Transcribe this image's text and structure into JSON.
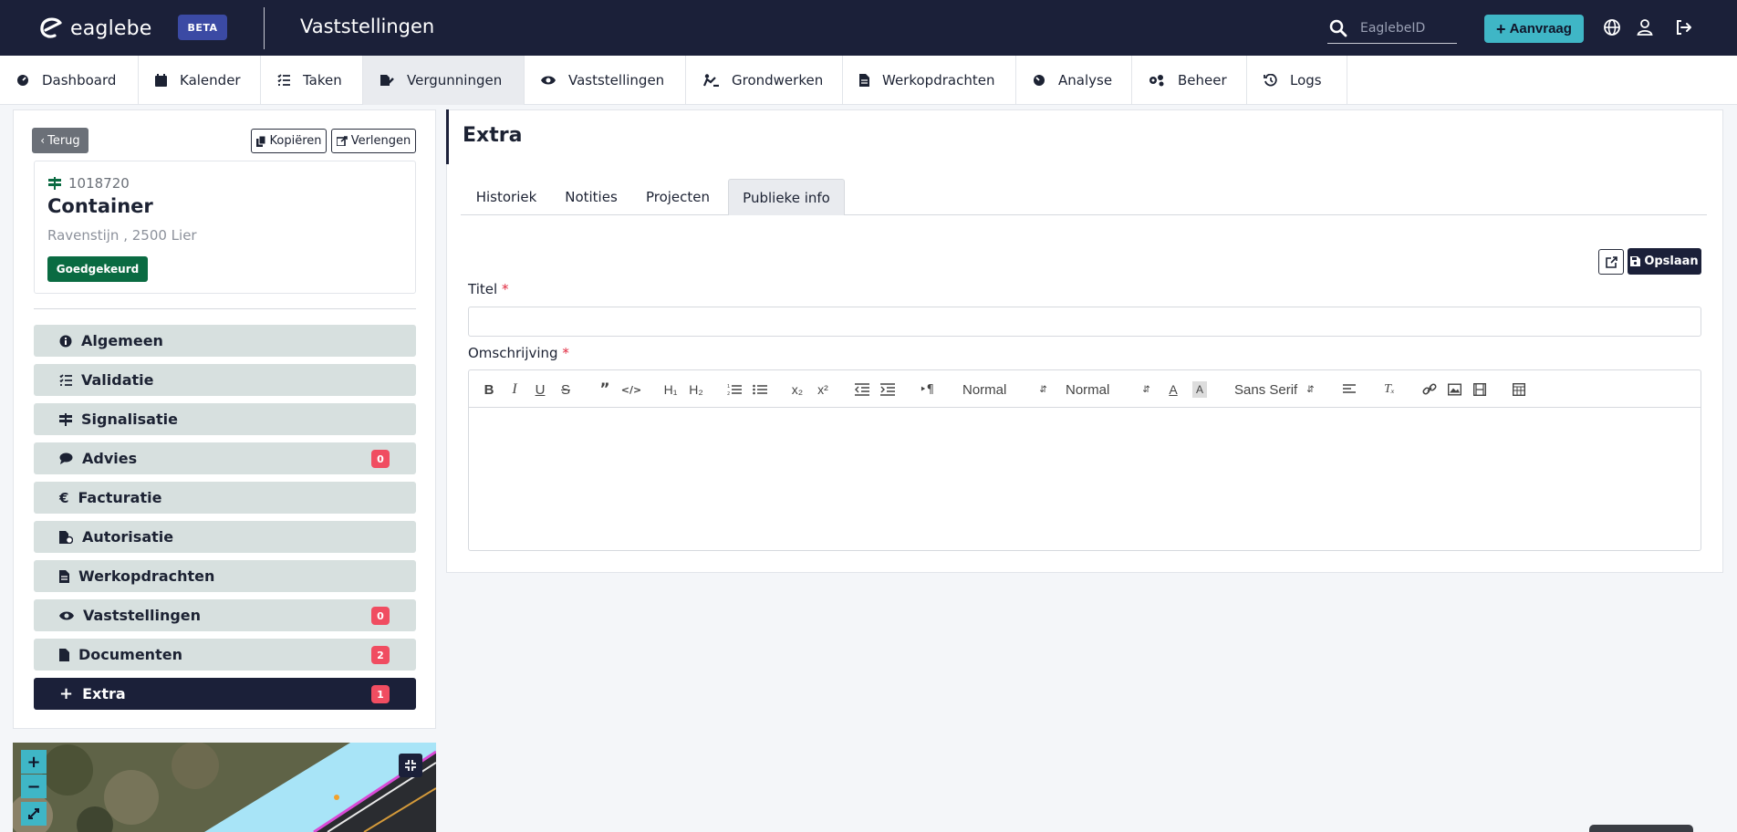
{
  "header": {
    "logo_text": "eaglebe",
    "beta_label": "BETA",
    "title": "Vaststellingen",
    "search_placeholder": "EaglebeID",
    "aanvraag_label": "Aanvraag",
    "icons": [
      "globe-icon",
      "user-icon",
      "logout-icon"
    ]
  },
  "nav": {
    "items": [
      {
        "label": "Dashboard",
        "icon": "dashboard-icon"
      },
      {
        "label": "Kalender",
        "icon": "calendar-icon"
      },
      {
        "label": "Taken",
        "icon": "tasks-icon"
      },
      {
        "label": "Vergunningen",
        "icon": "permit-icon",
        "active": true
      },
      {
        "label": "Vaststellingen",
        "icon": "eye-icon"
      },
      {
        "label": "Grondwerken",
        "icon": "digging-icon"
      },
      {
        "label": "Werkopdrachten",
        "icon": "file-icon"
      },
      {
        "label": "Analyse",
        "icon": "gauge-icon"
      },
      {
        "label": "Beheer",
        "icon": "gears-icon"
      },
      {
        "label": "Logs",
        "icon": "history-icon"
      }
    ]
  },
  "detail": {
    "back_label": "Terug",
    "copy_label": "Kopiëren",
    "extend_label": "Verlengen",
    "id": "1018720",
    "title": "Container",
    "address": "Ravenstijn , 2500 Lier",
    "status": "Goedgekeurd",
    "status_color": "#0a6b42"
  },
  "sidebar": {
    "items": [
      {
        "label": "Algemeen",
        "icon": "info-icon"
      },
      {
        "label": "Validatie",
        "icon": "checklist-icon"
      },
      {
        "label": "Signalisatie",
        "icon": "signpost-icon"
      },
      {
        "label": "Advies",
        "icon": "comments-icon",
        "count": "0"
      },
      {
        "label": "Facturatie",
        "icon": "euro-icon"
      },
      {
        "label": "Autorisatie",
        "icon": "file-shield-icon"
      },
      {
        "label": "Werkopdrachten",
        "icon": "file-icon"
      },
      {
        "label": "Vaststellingen",
        "icon": "eye-icon",
        "count": "0"
      },
      {
        "label": "Documenten",
        "icon": "document-icon",
        "count": "2"
      },
      {
        "label": "Extra",
        "icon": "plus-icon",
        "count": "1",
        "active": true
      }
    ]
  },
  "map": {
    "zoom_in": "+",
    "zoom_out": "−"
  },
  "extra": {
    "title": "Extra",
    "tabs": [
      {
        "label": "Historiek"
      },
      {
        "label": "Notities"
      },
      {
        "label": "Projecten"
      },
      {
        "label": "Publieke info",
        "active": true
      }
    ],
    "save_label": "Opslaan",
    "titel_label": "Titel",
    "omschrijving_label": "Omschrijving",
    "required_mark": "*",
    "titel_value": "",
    "editor": {
      "header_select": "Normal",
      "size_select": "Normal",
      "font_select": "Sans Serif"
    }
  },
  "colors": {
    "topbar": "#1b2039",
    "accent": "#3fb6c6",
    "badge_red": "#f04d61",
    "sidebar_item": "#d7e0df"
  }
}
